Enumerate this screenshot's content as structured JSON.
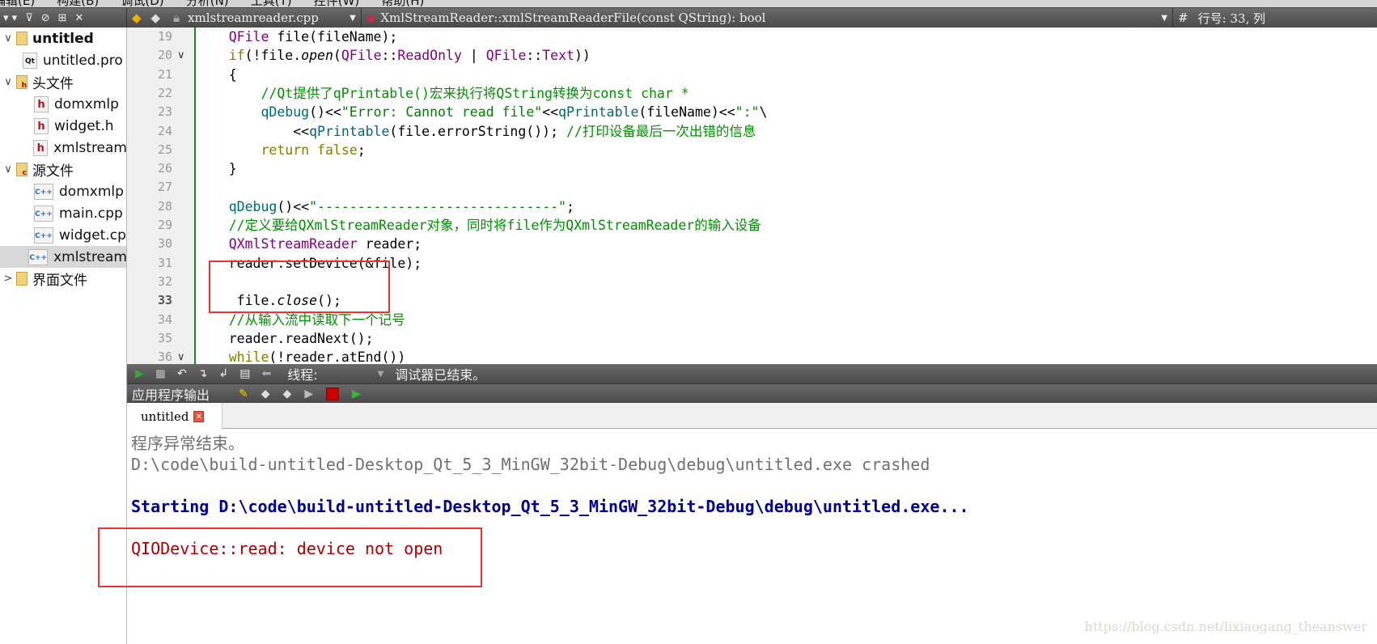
{
  "menubar": {
    "items": [
      "编辑(E)",
      "构建(B)",
      "调试(D)",
      "分析(N)",
      "工具(T)",
      "控件(W)",
      "帮助(H)"
    ]
  },
  "editor_toolbar": {
    "file": "xmlstreamreader.cpp",
    "function": "XmlStreamReader::xmlStreamReaderFile(const QString): bool",
    "hash": "#",
    "position": "行号: 33, 列"
  },
  "sidebar": {
    "items": [
      {
        "label": "untitled",
        "kind": "project",
        "bold": true
      },
      {
        "label": "untitled.pro",
        "kind": "pro"
      },
      {
        "label": "头文件",
        "kind": "folder-h"
      },
      {
        "label": "domxmlp",
        "kind": "h"
      },
      {
        "label": "widget.h",
        "kind": "h"
      },
      {
        "label": "xmlstream",
        "kind": "h"
      },
      {
        "label": "源文件",
        "kind": "folder-cpp"
      },
      {
        "label": "domxmlp",
        "kind": "cpp"
      },
      {
        "label": "main.cpp",
        "kind": "cpp"
      },
      {
        "label": "widget.cp",
        "kind": "cpp"
      },
      {
        "label": "xmlstream",
        "kind": "cpp",
        "selected": true
      },
      {
        "label": "界面文件",
        "kind": "folder-ui"
      }
    ]
  },
  "editor": {
    "current_line": 33,
    "lines": [
      {
        "n": 19,
        "t": [
          [
            "    ",
            "plain"
          ],
          [
            "QFile",
            "type"
          ],
          [
            " file(fileName);",
            "plain"
          ]
        ]
      },
      {
        "n": 20,
        "fold": true,
        "t": [
          [
            "    ",
            "plain"
          ],
          [
            "if",
            "kw"
          ],
          [
            "(!file.",
            "plain"
          ],
          [
            "open",
            "it"
          ],
          [
            "(",
            "plain"
          ],
          [
            "QFile",
            "type"
          ],
          [
            "::",
            "plain"
          ],
          [
            "ReadOnly",
            "type"
          ],
          [
            " | ",
            "plain"
          ],
          [
            "QFile",
            "type"
          ],
          [
            "::",
            "plain"
          ],
          [
            "Text",
            "type"
          ],
          [
            "))",
            "plain"
          ]
        ]
      },
      {
        "n": 21,
        "t": [
          [
            "    {",
            "plain"
          ]
        ]
      },
      {
        "n": 22,
        "t": [
          [
            "        ",
            "plain"
          ],
          [
            "//Qt提供了qPrintable()宏来执行将QString转换为const char *",
            "com"
          ]
        ]
      },
      {
        "n": 23,
        "t": [
          [
            "        ",
            "plain"
          ],
          [
            "qDebug",
            "fn"
          ],
          [
            "()<<",
            "plain"
          ],
          [
            "\"Error: Cannot read file\"",
            "str"
          ],
          [
            "<<",
            "plain"
          ],
          [
            "qPrintable",
            "fn"
          ],
          [
            "(fileName)<<",
            "plain"
          ],
          [
            "\":\"",
            "str"
          ],
          [
            "\\",
            "plain"
          ]
        ]
      },
      {
        "n": 24,
        "t": [
          [
            "            <<",
            "plain"
          ],
          [
            "qPrintable",
            "fn"
          ],
          [
            "(file.errorString()); ",
            "plain"
          ],
          [
            "//打印设备最后一次出错的信息",
            "com"
          ]
        ]
      },
      {
        "n": 25,
        "t": [
          [
            "        ",
            "plain"
          ],
          [
            "return false",
            "kw"
          ],
          [
            ";",
            "plain"
          ]
        ]
      },
      {
        "n": 26,
        "t": [
          [
            "    }",
            "plain"
          ]
        ]
      },
      {
        "n": 27,
        "t": []
      },
      {
        "n": 28,
        "t": [
          [
            "    ",
            "plain"
          ],
          [
            "qDebug",
            "fn"
          ],
          [
            "()<<",
            "plain"
          ],
          [
            "\"------------------------------\"",
            "str"
          ],
          [
            ";",
            "plain"
          ]
        ]
      },
      {
        "n": 29,
        "t": [
          [
            "    ",
            "plain"
          ],
          [
            "//定义要给QXmlStreamReader对象，同时将file作为QXmlStreamReader的输入设备",
            "com"
          ]
        ]
      },
      {
        "n": 30,
        "t": [
          [
            "    ",
            "plain"
          ],
          [
            "QXmlStreamReader",
            "type"
          ],
          [
            " reader;",
            "plain"
          ]
        ]
      },
      {
        "n": 31,
        "t": [
          [
            "    reader.setDevice(&file);",
            "plain"
          ]
        ]
      },
      {
        "n": 32,
        "t": []
      },
      {
        "n": 33,
        "t": [
          [
            "     file.",
            "plain"
          ],
          [
            "close",
            "it"
          ],
          [
            "();",
            "plain"
          ]
        ]
      },
      {
        "n": 34,
        "t": [
          [
            "    ",
            "plain"
          ],
          [
            "//从输入流中读取下一个记号",
            "com"
          ]
        ]
      },
      {
        "n": 35,
        "t": [
          [
            "    reader.readNext();",
            "plain"
          ]
        ]
      },
      {
        "n": 36,
        "fold": true,
        "t": [
          [
            "    ",
            "plain"
          ],
          [
            "while",
            "kw"
          ],
          [
            "(!reader.atEnd())",
            "plain"
          ]
        ]
      },
      {
        "n": 37,
        "t": [
          [
            "    {",
            "plain"
          ]
        ]
      }
    ]
  },
  "debug_toolbar": {
    "thread_label": "线程:",
    "status": "调试器已结束。"
  },
  "output_pane": {
    "title": "应用程序输出",
    "tab": "untitled",
    "lines": [
      {
        "text": "程序异常结束。",
        "color": "#707070"
      },
      {
        "text": "D:\\code\\build-untitled-Desktop_Qt_5_3_MinGW_32bit-Debug\\debug\\untitled.exe crashed",
        "color": "#707070"
      },
      {
        "text": "",
        "color": "#707070"
      },
      {
        "text": "Starting D:\\code\\build-untitled-Desktop_Qt_5_3_MinGW_32bit-Debug\\debug\\untitled.exe...",
        "color": "#00008b",
        "bold": true
      },
      {
        "text": "------------------------------",
        "color": "#aa0000"
      },
      {
        "text": "QIODevice::read: device not open",
        "color": "#aa0000"
      }
    ]
  },
  "watermark": "https://blog.csdn.net/lixiaogang_theanswer",
  "colors": {
    "highlight_box": "#ee3333",
    "gutter_marker": "#1a8a1a"
  }
}
